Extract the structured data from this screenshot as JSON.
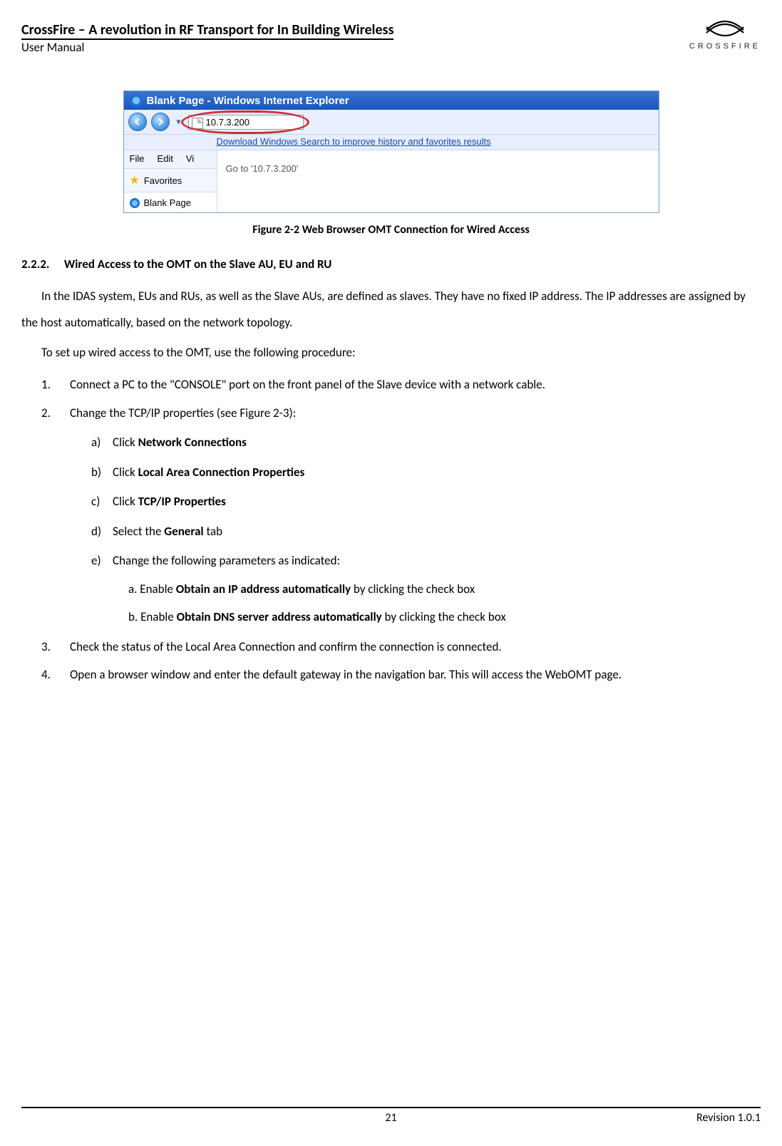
{
  "header": {
    "title": "CrossFire – A revolution in RF Transport for In Building Wireless",
    "subtitle": "User Manual",
    "logo_text": "CROSSFIRE"
  },
  "browser": {
    "titlebar": "Blank Page - Windows Internet Explorer",
    "address_value": "10.7.3.200",
    "download_link": "Download Windows Search to improve history and favorites results",
    "menu_file": "File",
    "menu_edit": "Edit",
    "menu_vi": "Vi",
    "favorites_label": "Favorites",
    "goto_prefix": "Go to '",
    "goto_value": "10.7.3.200",
    "goto_suffix": "'",
    "tab_label": "Blank Page"
  },
  "figure_caption": "Figure 2-2 Web Browser OMT Connection for Wired Access",
  "section": {
    "number": "2.2.2.",
    "title": "Wired Access to the OMT on the Slave AU, EU and RU"
  },
  "para1": "In the IDAS system, EUs and RUs, as well as the Slave AUs, are defined as slaves. They have no fixed IP address. The IP addresses are assigned by the host automatically, based on the network topology.",
  "para2": "To set up wired access to the OMT, use the following procedure:",
  "steps": {
    "s1": "Connect a PC to the \"CONSOLE\" port on the front panel of the Slave device with a network cable.",
    "s2": "Change the TCP/IP properties (see Figure 2-3):",
    "s2a_pre": "Click ",
    "s2a_b": "Network Connections",
    "s2b_pre": "Click ",
    "s2b_b": "Local Area Connection Properties",
    "s2c_pre": "Click ",
    "s2c_b": "TCP/IP Properties",
    "s2d_pre": "Select the ",
    "s2d_b": "General",
    "s2d_post": " tab",
    "s2e": "Change the following parameters as indicated:",
    "s2e_a_pre": "a. Enable ",
    "s2e_a_b": "Obtain an IP address automatically",
    "s2e_a_post": " by clicking the check box",
    "s2e_b_pre": "b. Enable ",
    "s2e_b_b": "Obtain DNS server address automatically",
    "s2e_b_post": " by clicking the check box",
    "s3": "Check the status of the Local Area Connection and confirm the connection is connected.",
    "s4": "Open a browser window and enter the default gateway in the navigation bar. This will access the WebOMT page."
  },
  "markers": {
    "m1": "1.",
    "m2": "2.",
    "m3": "3.",
    "m4": "4.",
    "ma": "a)",
    "mb": "b)",
    "mc": "c)",
    "md": "d)",
    "me": "e)"
  },
  "footer": {
    "page": "21",
    "revision": "Revision 1.0.1"
  }
}
